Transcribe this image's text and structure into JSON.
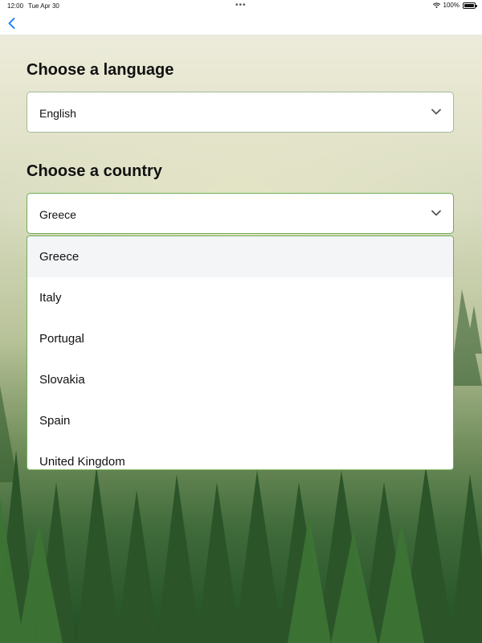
{
  "status_bar": {
    "time": "12:00",
    "date": "Tue Apr 30",
    "dots": "•••",
    "battery_percent": "100%"
  },
  "nav": {
    "back_icon": "chevron-left-icon"
  },
  "language": {
    "title": "Choose a language",
    "selected": "English"
  },
  "country": {
    "title": "Choose a country",
    "selected": "Greece",
    "options": [
      "Greece",
      "Italy",
      "Portugal",
      "Slovakia",
      "Spain",
      "United Kingdom"
    ]
  },
  "colors": {
    "accent_blue": "#0a7aff",
    "border_active": "#6fae53",
    "selected_row": "#f4f5f7"
  }
}
